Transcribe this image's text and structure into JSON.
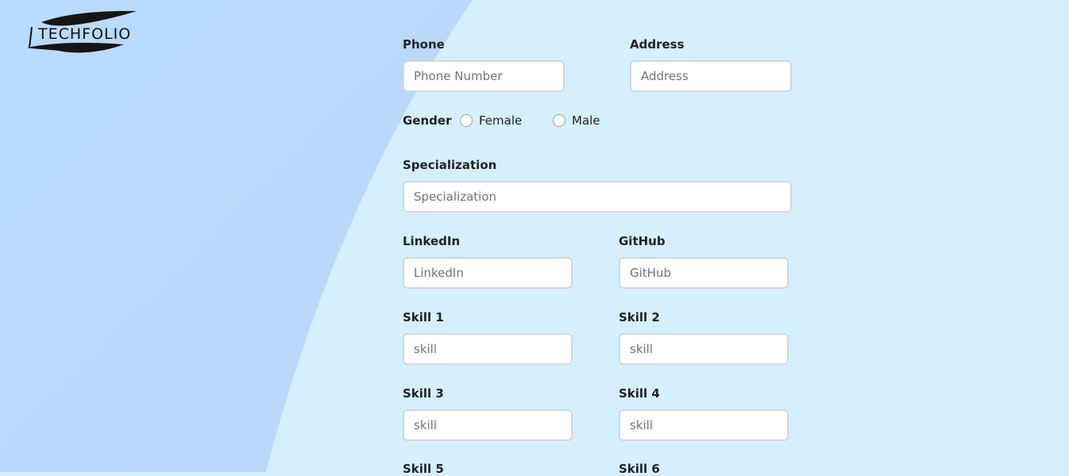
{
  "brand": {
    "name": "TECHFOLIO"
  },
  "form": {
    "phone": {
      "label": "Phone",
      "placeholder": "Phone Number"
    },
    "address": {
      "label": "Address",
      "placeholder": "Address"
    },
    "gender": {
      "label": "Gender",
      "options": [
        "Female",
        "Male"
      ]
    },
    "specialization": {
      "label": "Specialization",
      "placeholder": "Specialization"
    },
    "linkedin": {
      "label": "LinkedIn",
      "placeholder": "LinkedIn"
    },
    "github": {
      "label": "GitHub",
      "placeholder": "GitHub"
    },
    "skills": [
      {
        "label": "Skill 1",
        "placeholder": "skill"
      },
      {
        "label": "Skill 2",
        "placeholder": "skill"
      },
      {
        "label": "Skill 3",
        "placeholder": "skill"
      },
      {
        "label": "Skill 4",
        "placeholder": "skill"
      },
      {
        "label": "Skill 5"
      },
      {
        "label": "Skill 6"
      }
    ]
  }
}
